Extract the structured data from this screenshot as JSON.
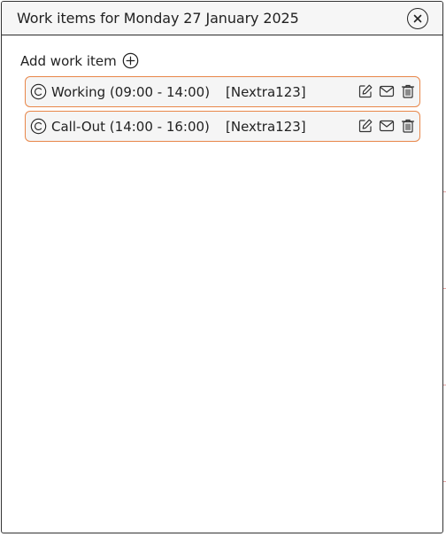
{
  "dialog": {
    "title": "Work items for Monday 27 January 2025",
    "close_icon": "close-circle-icon"
  },
  "add": {
    "label": "Add work item",
    "icon": "plus-circle-icon"
  },
  "work_items": [
    {
      "label": "Working (09:00 - 14:00)",
      "reference": "[Nextra123]",
      "status_icon": "copyright-circle-icon"
    },
    {
      "label": "Call-Out (14:00 - 16:00)",
      "reference": "[Nextra123]",
      "status_icon": "copyright-circle-icon"
    }
  ],
  "colors": {
    "item_border": "#e8874a",
    "item_background": "#f5f5f5",
    "header_background": "#f6f6f6"
  }
}
